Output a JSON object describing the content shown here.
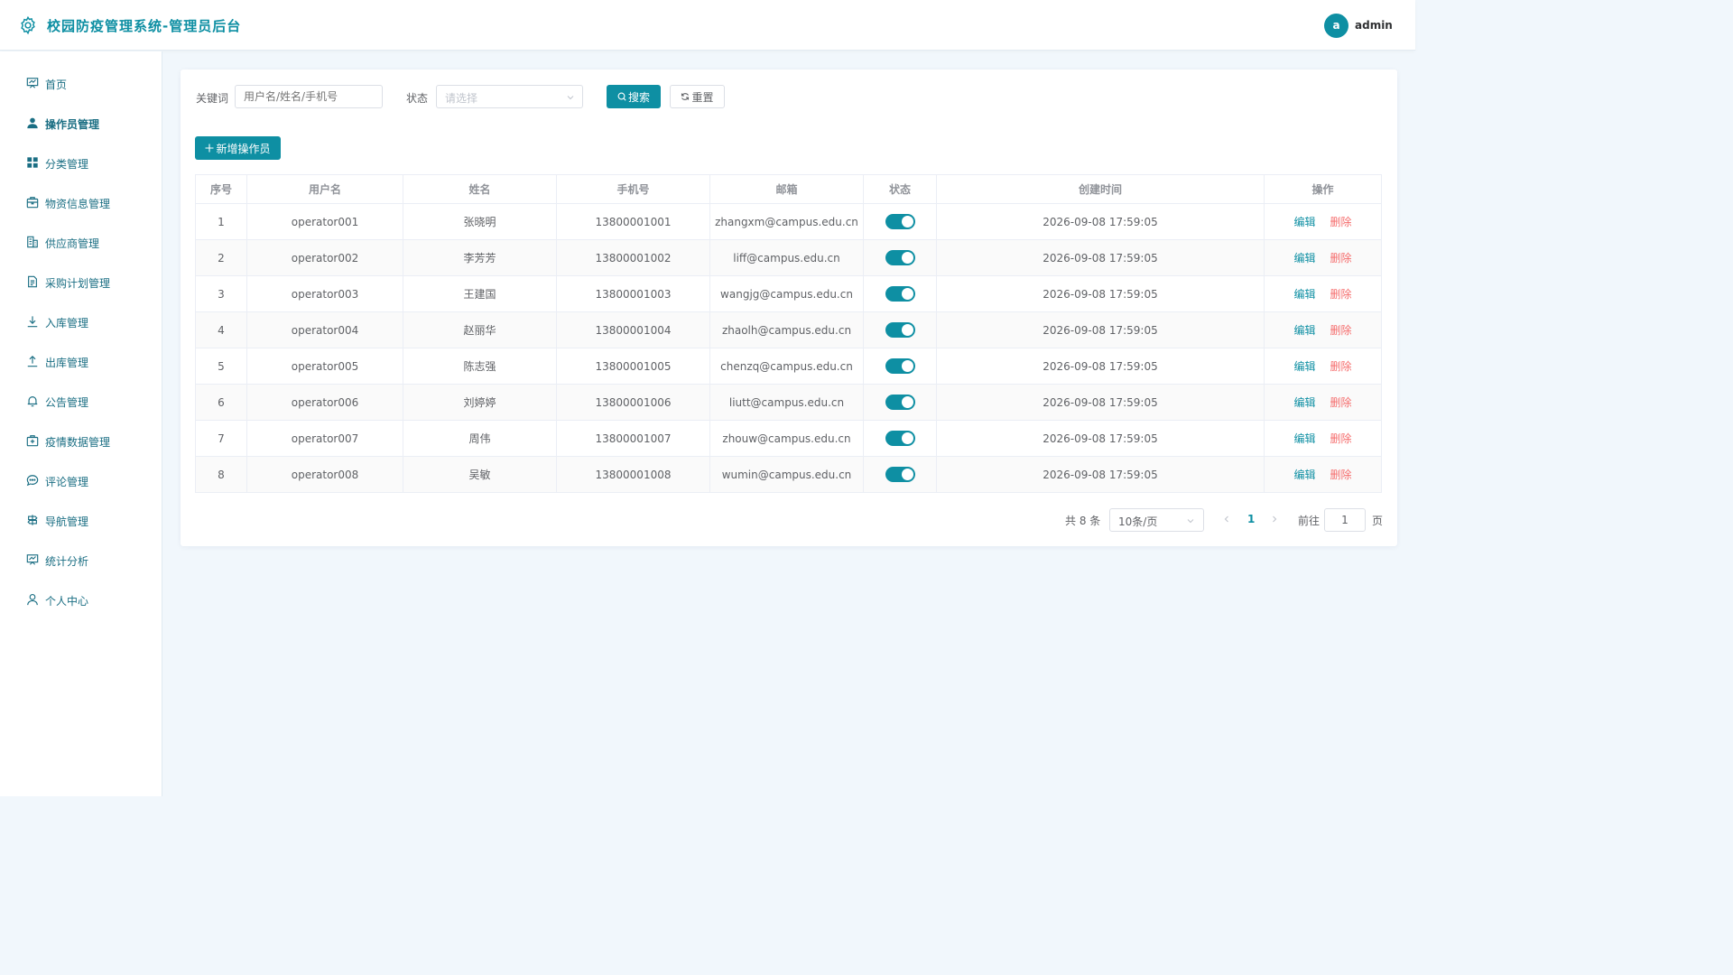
{
  "header": {
    "title": "校园防疫管理系统-管理员后台",
    "avatar_letter": "a",
    "username": "admin"
  },
  "sidebar": {
    "items": [
      {
        "label": "首页",
        "icon": "dashboard-icon",
        "active": false
      },
      {
        "label": "操作员管理",
        "icon": "user-icon",
        "active": true
      },
      {
        "label": "分类管理",
        "icon": "grid-icon",
        "active": false
      },
      {
        "label": "物资信息管理",
        "icon": "box-icon",
        "active": false
      },
      {
        "label": "供应商管理",
        "icon": "building-icon",
        "active": false
      },
      {
        "label": "采购计划管理",
        "icon": "document-icon",
        "active": false
      },
      {
        "label": "入库管理",
        "icon": "download-icon",
        "active": false
      },
      {
        "label": "出库管理",
        "icon": "upload-icon",
        "active": false
      },
      {
        "label": "公告管理",
        "icon": "bell-icon",
        "active": false
      },
      {
        "label": "疫情数据管理",
        "icon": "medical-box-icon",
        "active": false
      },
      {
        "label": "评论管理",
        "icon": "chat-icon",
        "active": false
      },
      {
        "label": "导航管理",
        "icon": "guide-icon",
        "active": false
      },
      {
        "label": "统计分析",
        "icon": "chart-icon",
        "active": false
      },
      {
        "label": "个人中心",
        "icon": "person-icon",
        "active": false
      }
    ]
  },
  "filters": {
    "keyword_label": "关键词",
    "keyword_placeholder": "用户名/姓名/手机号",
    "status_label": "状态",
    "status_placeholder": "请选择",
    "search_label": "搜索",
    "reset_label": "重置"
  },
  "add_button": "新增操作员",
  "table": {
    "columns": [
      "序号",
      "用户名",
      "姓名",
      "手机号",
      "邮箱",
      "状态",
      "创建时间",
      "操作"
    ],
    "rows": [
      {
        "index": "1",
        "username": "operator001",
        "name": "张晓明",
        "phone": "13800001001",
        "email": "zhangxm@campus.edu.cn",
        "enabled": true,
        "created": "2026-09-08 17:59:05"
      },
      {
        "index": "2",
        "username": "operator002",
        "name": "李芳芳",
        "phone": "13800001002",
        "email": "liff@campus.edu.cn",
        "enabled": true,
        "created": "2026-09-08 17:59:05"
      },
      {
        "index": "3",
        "username": "operator003",
        "name": "王建国",
        "phone": "13800001003",
        "email": "wangjg@campus.edu.cn",
        "enabled": true,
        "created": "2026-09-08 17:59:05"
      },
      {
        "index": "4",
        "username": "operator004",
        "name": "赵丽华",
        "phone": "13800001004",
        "email": "zhaolh@campus.edu.cn",
        "enabled": true,
        "created": "2026-09-08 17:59:05"
      },
      {
        "index": "5",
        "username": "operator005",
        "name": "陈志强",
        "phone": "13800001005",
        "email": "chenzq@campus.edu.cn",
        "enabled": true,
        "created": "2026-09-08 17:59:05"
      },
      {
        "index": "6",
        "username": "operator006",
        "name": "刘婷婷",
        "phone": "13800001006",
        "email": "liutt@campus.edu.cn",
        "enabled": true,
        "created": "2026-09-08 17:59:05"
      },
      {
        "index": "7",
        "username": "operator007",
        "name": "周伟",
        "phone": "13800001007",
        "email": "zhouw@campus.edu.cn",
        "enabled": true,
        "created": "2026-09-08 17:59:05"
      },
      {
        "index": "8",
        "username": "operator008",
        "name": "吴敏",
        "phone": "13800001008",
        "email": "wumin@campus.edu.cn",
        "enabled": true,
        "created": "2026-09-08 17:59:05"
      }
    ],
    "edit_label": "编辑",
    "delete_label": "删除"
  },
  "pagination": {
    "total_text": "共 8 条",
    "page_size": "10条/页",
    "current_page": "1",
    "goto_label": "前往",
    "goto_value": "1",
    "page_unit": "页"
  },
  "colors": {
    "primary": "#0e8fa3",
    "danger": "#f56c6c",
    "background": "#f1f7fc"
  }
}
